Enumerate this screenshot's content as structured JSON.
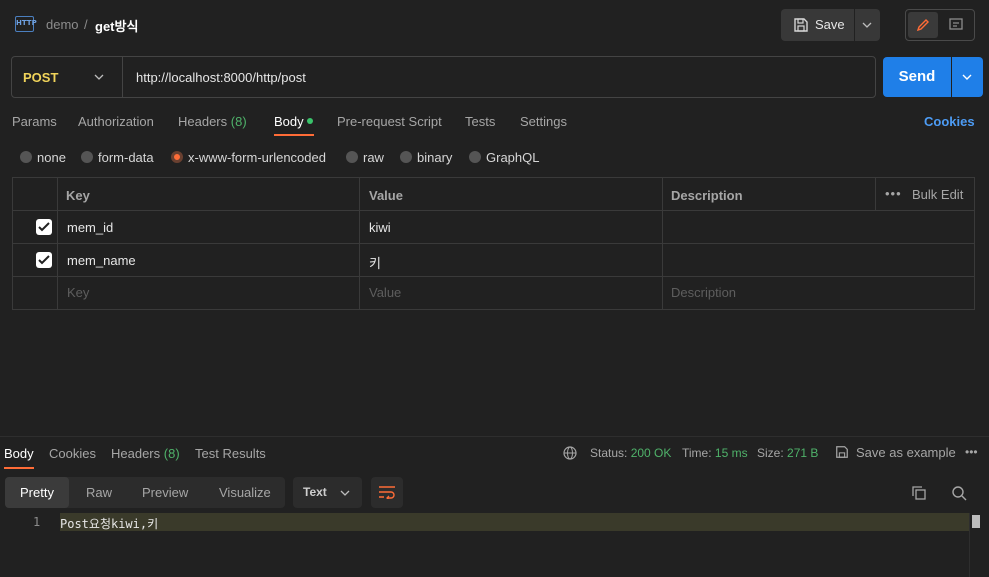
{
  "header": {
    "badge": "HTTP",
    "breadcrumb_parent": "demo",
    "breadcrumb_sep": "/",
    "breadcrumb_current": "get방식",
    "save_label": "Save"
  },
  "request": {
    "method": "POST",
    "url": "http://localhost:8000/http/post",
    "send_label": "Send"
  },
  "tabs": {
    "params": "Params",
    "authorization": "Authorization",
    "headers": "Headers",
    "headers_count": "(8)",
    "body": "Body",
    "prerequest": "Pre-request Script",
    "tests": "Tests",
    "settings": "Settings",
    "cookies": "Cookies",
    "active": "Body"
  },
  "body_types": [
    "none",
    "form-data",
    "x-www-form-urlencoded",
    "raw",
    "binary",
    "GraphQL"
  ],
  "body_type_selected": "x-www-form-urlencoded",
  "table": {
    "col_key": "Key",
    "col_value": "Value",
    "col_description": "Description",
    "bulk_edit": "Bulk Edit",
    "more": "•••",
    "rows": [
      {
        "checked": true,
        "key": "mem_id",
        "value": "kiwi",
        "description": ""
      },
      {
        "checked": true,
        "key": "mem_name",
        "value": "키",
        "description": ""
      }
    ],
    "placeholder": {
      "key": "Key",
      "value": "Value",
      "description": "Description"
    }
  },
  "response": {
    "tabs": {
      "body": "Body",
      "cookies": "Cookies",
      "headers": "Headers",
      "headers_count": "(8)",
      "test_results": "Test Results"
    },
    "status_label": "Status:",
    "status_value": "200 OK",
    "time_label": "Time:",
    "time_value": "15 ms",
    "size_label": "Size:",
    "size_value": "271 B",
    "save_example": "Save as example",
    "more": "•••",
    "view_modes": [
      "Pretty",
      "Raw",
      "Preview",
      "Visualize"
    ],
    "view_selected": "Pretty",
    "format": "Text",
    "lines": [
      {
        "no": "1",
        "text": "Post요청kiwi,키"
      }
    ]
  },
  "colors": {
    "accent": "#ff6c37",
    "send": "#1f7fe8",
    "method": "#f0d35a",
    "success": "#4fb26a",
    "link": "#4d9cf5"
  }
}
